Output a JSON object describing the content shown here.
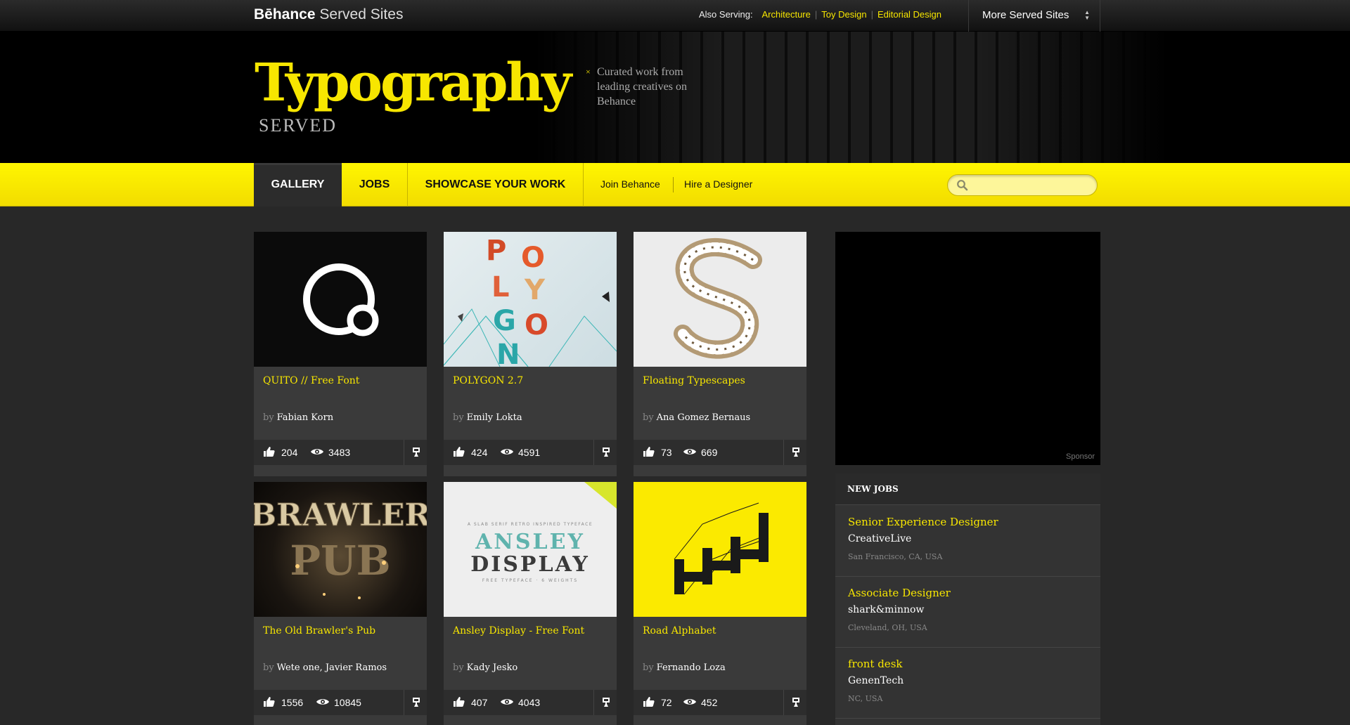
{
  "topbar": {
    "brand_bold": "Bēhance",
    "brand_rest": " Served Sites",
    "also_label": "Also Serving:",
    "also_links": [
      "Architecture",
      "Toy Design",
      "Editorial Design"
    ],
    "more_label": "More Served Sites"
  },
  "header": {
    "title": "Typography",
    "subtitle": "SERVED",
    "tagline": "Curated work from leading creatives on Behance"
  },
  "nav": {
    "tabs": [
      "GALLERY",
      "JOBS",
      "SHOWCASE YOUR WORK"
    ],
    "active_tab": "GALLERY",
    "links": [
      "Join Behance",
      "Hire a Designer"
    ],
    "search_placeholder": ""
  },
  "projects": [
    {
      "title": "QUITO // Free Font",
      "by_label": "by",
      "author": "Fabian Korn",
      "appreciations": "204",
      "views": "3483"
    },
    {
      "title": "POLYGON 2.7",
      "by_label": "by",
      "author": "Emily Lokta",
      "appreciations": "424",
      "views": "4591"
    },
    {
      "title": "Floating Typescapes",
      "by_label": "by",
      "author": "Ana Gomez Bernaus",
      "appreciations": "73",
      "views": "669"
    },
    {
      "title": "The Old Brawler's Pub",
      "by_label": "by",
      "author": "Wete one, Javier Ramos",
      "appreciations": "1556",
      "views": "10845"
    },
    {
      "title": "Ansley Display - Free Font",
      "by_label": "by",
      "author": "Kady Jesko",
      "appreciations": "407",
      "views": "4043"
    },
    {
      "title": "Road Alphabet",
      "by_label": "by",
      "author": "Fernando Loza",
      "appreciations": "72",
      "views": "452"
    }
  ],
  "thumb_text": {
    "polygon": "POLYGON",
    "brawler_top": "BRAWLER",
    "brawler_bottom": "PUB",
    "ansley_small": "A SLAB SERIF RETRO INSPIRED TYPEFACE",
    "ansley_line1": "ANSLEY",
    "ansley_line2": "DISPLAY",
    "ansley_foot": "FREE TYPEFACE · 6 WEIGHTS"
  },
  "sidebar": {
    "sponsor_label": "Sponsor",
    "jobs_heading": "NEW JOBS",
    "jobs": [
      {
        "title": "Senior Experience Designer",
        "company": "CreativeLive",
        "location": "San Francisco, CA, USA"
      },
      {
        "title": "Associate Designer",
        "company": "shark&minnow",
        "location": "Cleveland, OH, USA"
      },
      {
        "title": "front desk",
        "company": "GenenTech",
        "location": "NC, USA"
      }
    ]
  },
  "colors": {
    "accent": "#f7e600",
    "background": "#282828",
    "card": "#3a3a3a"
  },
  "icons": [
    "thumbs-up-icon",
    "eye-icon",
    "featured-icon",
    "search-icon",
    "sort-arrows-icon",
    "close-icon"
  ]
}
